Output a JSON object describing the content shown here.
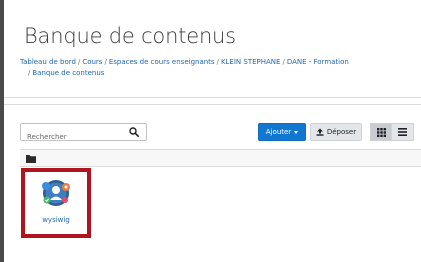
{
  "page": {
    "title": "Banque de contenus"
  },
  "breadcrumb": {
    "items": [
      "Tableau de bord",
      "Cours",
      "Espaces de cours enseignants",
      "KLEIN STEPHANE",
      "DANE - Formation",
      "Banque de contenus"
    ],
    "separator": "/"
  },
  "toolbar": {
    "search_placeholder": "Rechercher",
    "add_label": "Ajouter",
    "upload_label": "Déposer"
  },
  "content": {
    "items": [
      {
        "name": "wysiwig",
        "icon": "h5p-content-icon"
      }
    ]
  },
  "colors": {
    "accent": "#0f6cbf",
    "link": "#1f69b3",
    "highlight_border": "#b0151f"
  }
}
